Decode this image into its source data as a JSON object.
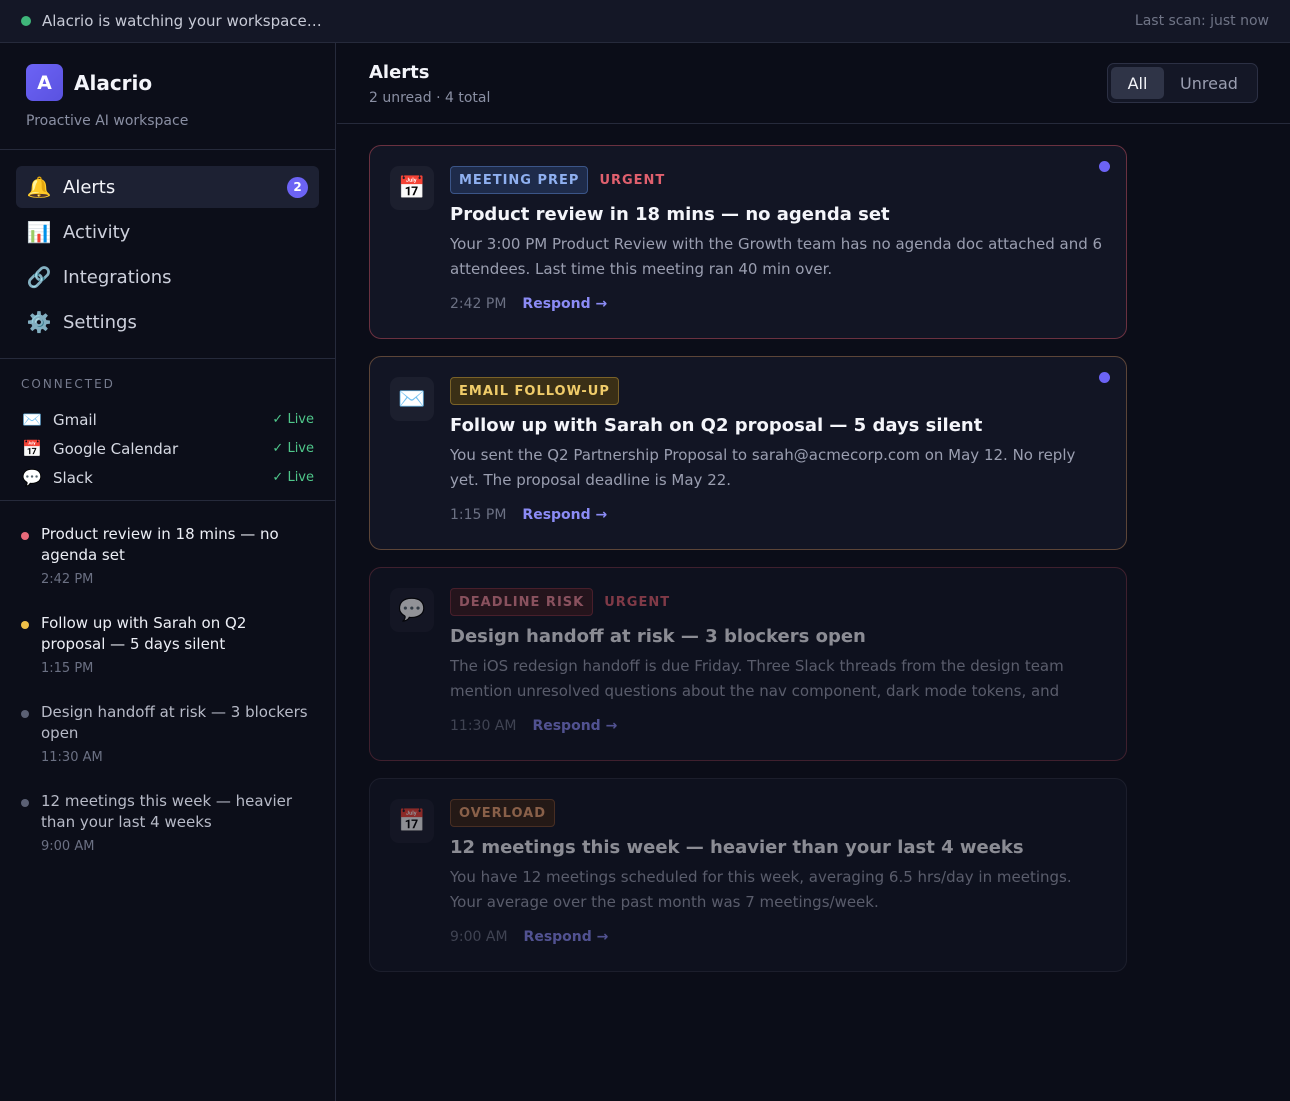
{
  "topbar": {
    "status": "Alacrio is watching your workspace…",
    "last_scan": "Last scan: just now",
    "status_color": "#3fb67a"
  },
  "brand": {
    "logo_letter": "A",
    "name": "Alacrio",
    "subtitle": "Proactive AI workspace"
  },
  "nav": [
    {
      "label": "Alerts",
      "icon": "bell-icon",
      "glyph": "🔔",
      "badge": "2",
      "active": true
    },
    {
      "label": "Activity",
      "icon": "bar-chart-icon",
      "glyph": "📊"
    },
    {
      "label": "Integrations",
      "icon": "link-icon",
      "glyph": "🔗"
    },
    {
      "label": "Settings",
      "icon": "gear-icon",
      "glyph": "⚙️"
    }
  ],
  "connected": {
    "label": "CONNECTED",
    "items": [
      {
        "name": "Gmail",
        "icon": "envelope-icon",
        "glyph": "✉️",
        "status": "✓ Live"
      },
      {
        "name": "Google Calendar",
        "icon": "calendar-icon",
        "glyph": "📅",
        "status": "✓ Live"
      },
      {
        "name": "Slack",
        "icon": "speech-bubble-icon",
        "glyph": "💬",
        "status": "✓ Live"
      }
    ]
  },
  "recent": [
    {
      "title": "Product review in 18 mins — no agenda set",
      "time": "2:42 PM",
      "dot_color": "#e86a7a"
    },
    {
      "title": "Follow up with Sarah on Q2 proposal — 5 days silent",
      "time": "1:15 PM",
      "dot_color": "#f0c048"
    },
    {
      "title": "Design handoff at risk — 3 blockers open",
      "time": "11:30 AM",
      "dot_color": "#5b6074"
    },
    {
      "title": "12 meetings this week — heavier than your last 4 weeks",
      "time": "9:00 AM",
      "dot_color": "#5b6074"
    }
  ],
  "header": {
    "title": "Alerts",
    "subtitle": "2 unread · 4 total",
    "filter_all": "All",
    "filter_unread": "Unread"
  },
  "cards": [
    {
      "icon": "calendar-icon",
      "glyph": "📅",
      "tag": "MEETING PREP",
      "urgent": "URGENT",
      "title": "Product review in 18 mins — no agenda set",
      "body": "Your 3:00 PM Product Review with the Growth team has no agenda doc attached and 6 attendees. Last time this meeting ran 40 min over.",
      "time": "2:42 PM",
      "action": "Respond →"
    },
    {
      "icon": "envelope-icon",
      "glyph": "✉️",
      "tag": "EMAIL FOLLOW-UP",
      "urgent": "",
      "title": "Follow up with Sarah on Q2 proposal — 5 days silent",
      "body": "You sent the Q2 Partnership Proposal to sarah@acmecorp.com on May 12. No reply yet. The proposal deadline is May 22.",
      "time": "1:15 PM",
      "action": "Respond →"
    },
    {
      "icon": "speech-bubble-icon",
      "glyph": "💬",
      "tag": "DEADLINE RISK",
      "urgent": "URGENT",
      "title": "Design handoff at risk — 3 blockers open",
      "body": "The iOS redesign handoff is due Friday. Three Slack threads from the design team mention unresolved questions about the nav component, dark mode tokens, and expo...",
      "time": "11:30 AM",
      "action": "Respond →"
    },
    {
      "icon": "calendar-icon",
      "glyph": "📅",
      "tag": "OVERLOAD",
      "urgent": "",
      "title": "12 meetings this week — heavier than your last 4 weeks",
      "body": "You have 12 meetings scheduled for this week, averaging 6.5 hrs/day in meetings. Your average over the past month was 7 meetings/week.",
      "time": "9:00 AM",
      "action": "Respond →"
    }
  ],
  "colors": {
    "accent": "#6c63f5",
    "live": "#4fc68a",
    "urgent": "#e0606e"
  }
}
